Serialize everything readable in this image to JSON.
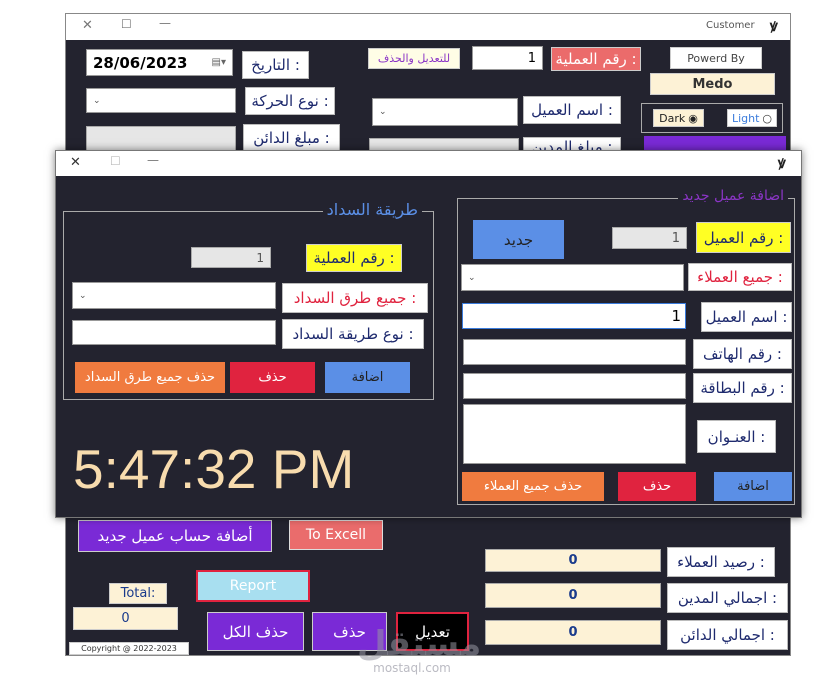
{
  "main": {
    "title": "Customer",
    "date_label": "التاريخ :",
    "date_value": "28/06/2023",
    "movement_type_label": "نوع الحركة :",
    "creditor_amount_label": "مبلغ الدائن :",
    "debtor_amount_label": "مبلغ المدين :",
    "edit_delete_label": "للتعديل والحذف",
    "operation_no_label": "رقم العملية :",
    "operation_no_value": "1",
    "customer_name_label": "اسم العميل :",
    "powered_by": "Powerd By",
    "author": "Medo",
    "theme_dark": "Dark",
    "theme_light": "Light",
    "add_account_button": "أضافة حساب عميل جديد",
    "excel_button": "To Excell",
    "report_button": "Report",
    "total_label": "Total:",
    "total_value": "0",
    "copyright": "Copyright @ 2022-2023",
    "delete_all_button": "حذف الكل",
    "delete_button": "حذف",
    "edit_button": "تعديل",
    "customers_balance_label": "رصيد العملاء :",
    "customers_balance_value": "0",
    "total_debtor_label": "اجمالي المدين :",
    "total_debtor_value": "0",
    "total_creditor_label": "اجمالي الدائن :",
    "total_creditor_value": "0"
  },
  "dialog": {
    "payment_group": {
      "title": "طريقة السداد",
      "operation_no_label": "رقم العملية :",
      "operation_no_value": "1",
      "all_methods_label": "جميع طرق السداد :",
      "method_type_label": "نوع طريقة السداد :",
      "add_button": "اضافة",
      "delete_button": "حذف",
      "delete_all_button": "حذف جميع طرق السداد"
    },
    "customer_group": {
      "title": "اضافة عميل جديد",
      "new_button": "جديد",
      "customer_no_label": "رقم العميل :",
      "customer_no_value": "1",
      "all_customers_label": "جميع العملاء :",
      "customer_name_label": "اسم العميل :",
      "customer_name_value": "1",
      "phone_label": "رقم الهاتف :",
      "card_label": "رقم البطاقة :",
      "address_label": "العنـوان :",
      "add_button": "اضافة",
      "delete_button": "حذف",
      "delete_all_button": "حذف جميع  العملاء"
    },
    "clock": "5:47:32 PM"
  },
  "watermark": {
    "arabic": "مستقل",
    "latin": "mostaql.com"
  },
  "colors": {
    "dark_bg": "#23232f",
    "purple": "#7a2ad6",
    "coral": "#f07b3f",
    "red": "#e0233f",
    "blue": "#5b8fe6",
    "yellow": "#ffff24",
    "salmon": "#ea6c6c",
    "clock": "#f8dcae"
  }
}
